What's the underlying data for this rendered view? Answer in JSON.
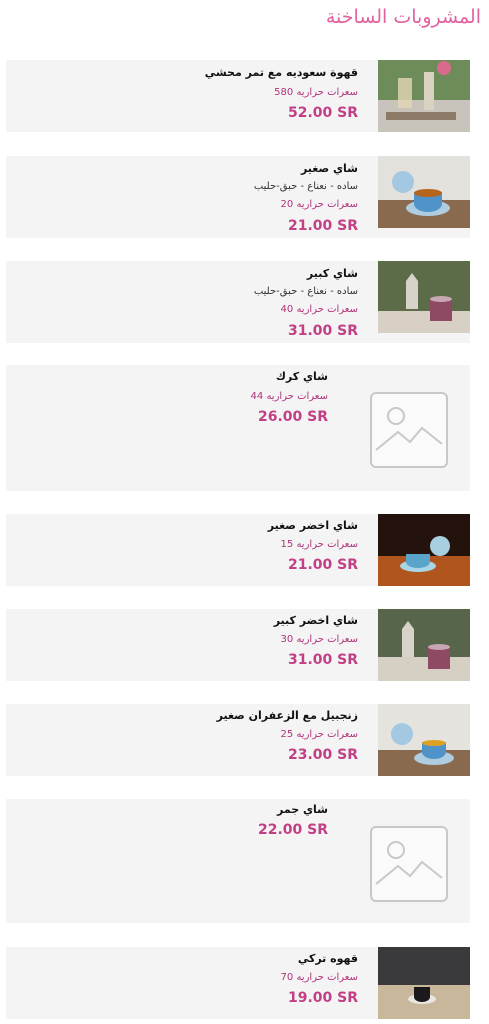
{
  "page": {
    "title": "المشروبات الساخنة"
  },
  "items": [
    {
      "name": "قهوة سعوديه مع تمر محشي",
      "calories": "سعرات حراريه 580",
      "price": "52.00 SR",
      "image": "coffee-dates-photo"
    },
    {
      "name": "شاي صغير",
      "description": "ساده - نعناع - حبق-حليب",
      "calories": "سعرات حراريه 20",
      "price": "21.00 SR",
      "image": "tea-cup-photo"
    },
    {
      "name": "شاي كبير",
      "description": "ساده - نعناع - حبق-حليب",
      "calories": "سعرات حراريه 40",
      "price": "31.00 SR",
      "image": "teapot-photo"
    },
    {
      "name": "شاي كرك",
      "calories": "سعرات حراريه 44",
      "price": "26.00 SR",
      "image": "image-placeholder-icon"
    },
    {
      "name": "شاي اخضر صغير",
      "calories": "سعرات حراريه 15",
      "price": "21.00 SR",
      "image": "green-tea-photo"
    },
    {
      "name": "شاي اخضر كبير",
      "calories": "سعرات حراريه 30",
      "price": "31.00 SR",
      "image": "teapot-photo"
    },
    {
      "name": "زنجبيل مع الزعفران صغير",
      "calories": "سعرات حراريه 25",
      "price": "23.00 SR",
      "image": "tea-cup-photo"
    },
    {
      "name": "شاي جمر",
      "price": "22.00 SR",
      "image": "image-placeholder-icon"
    },
    {
      "name": "قهوه تركي",
      "calories": "سعرات حراريه 70",
      "price": "19.00 SR",
      "image": "turkish-coffee-photo"
    }
  ],
  "colors": {
    "accent": "#e0629f",
    "price": "#c23f86",
    "card_bg": "#f4f4f4"
  }
}
